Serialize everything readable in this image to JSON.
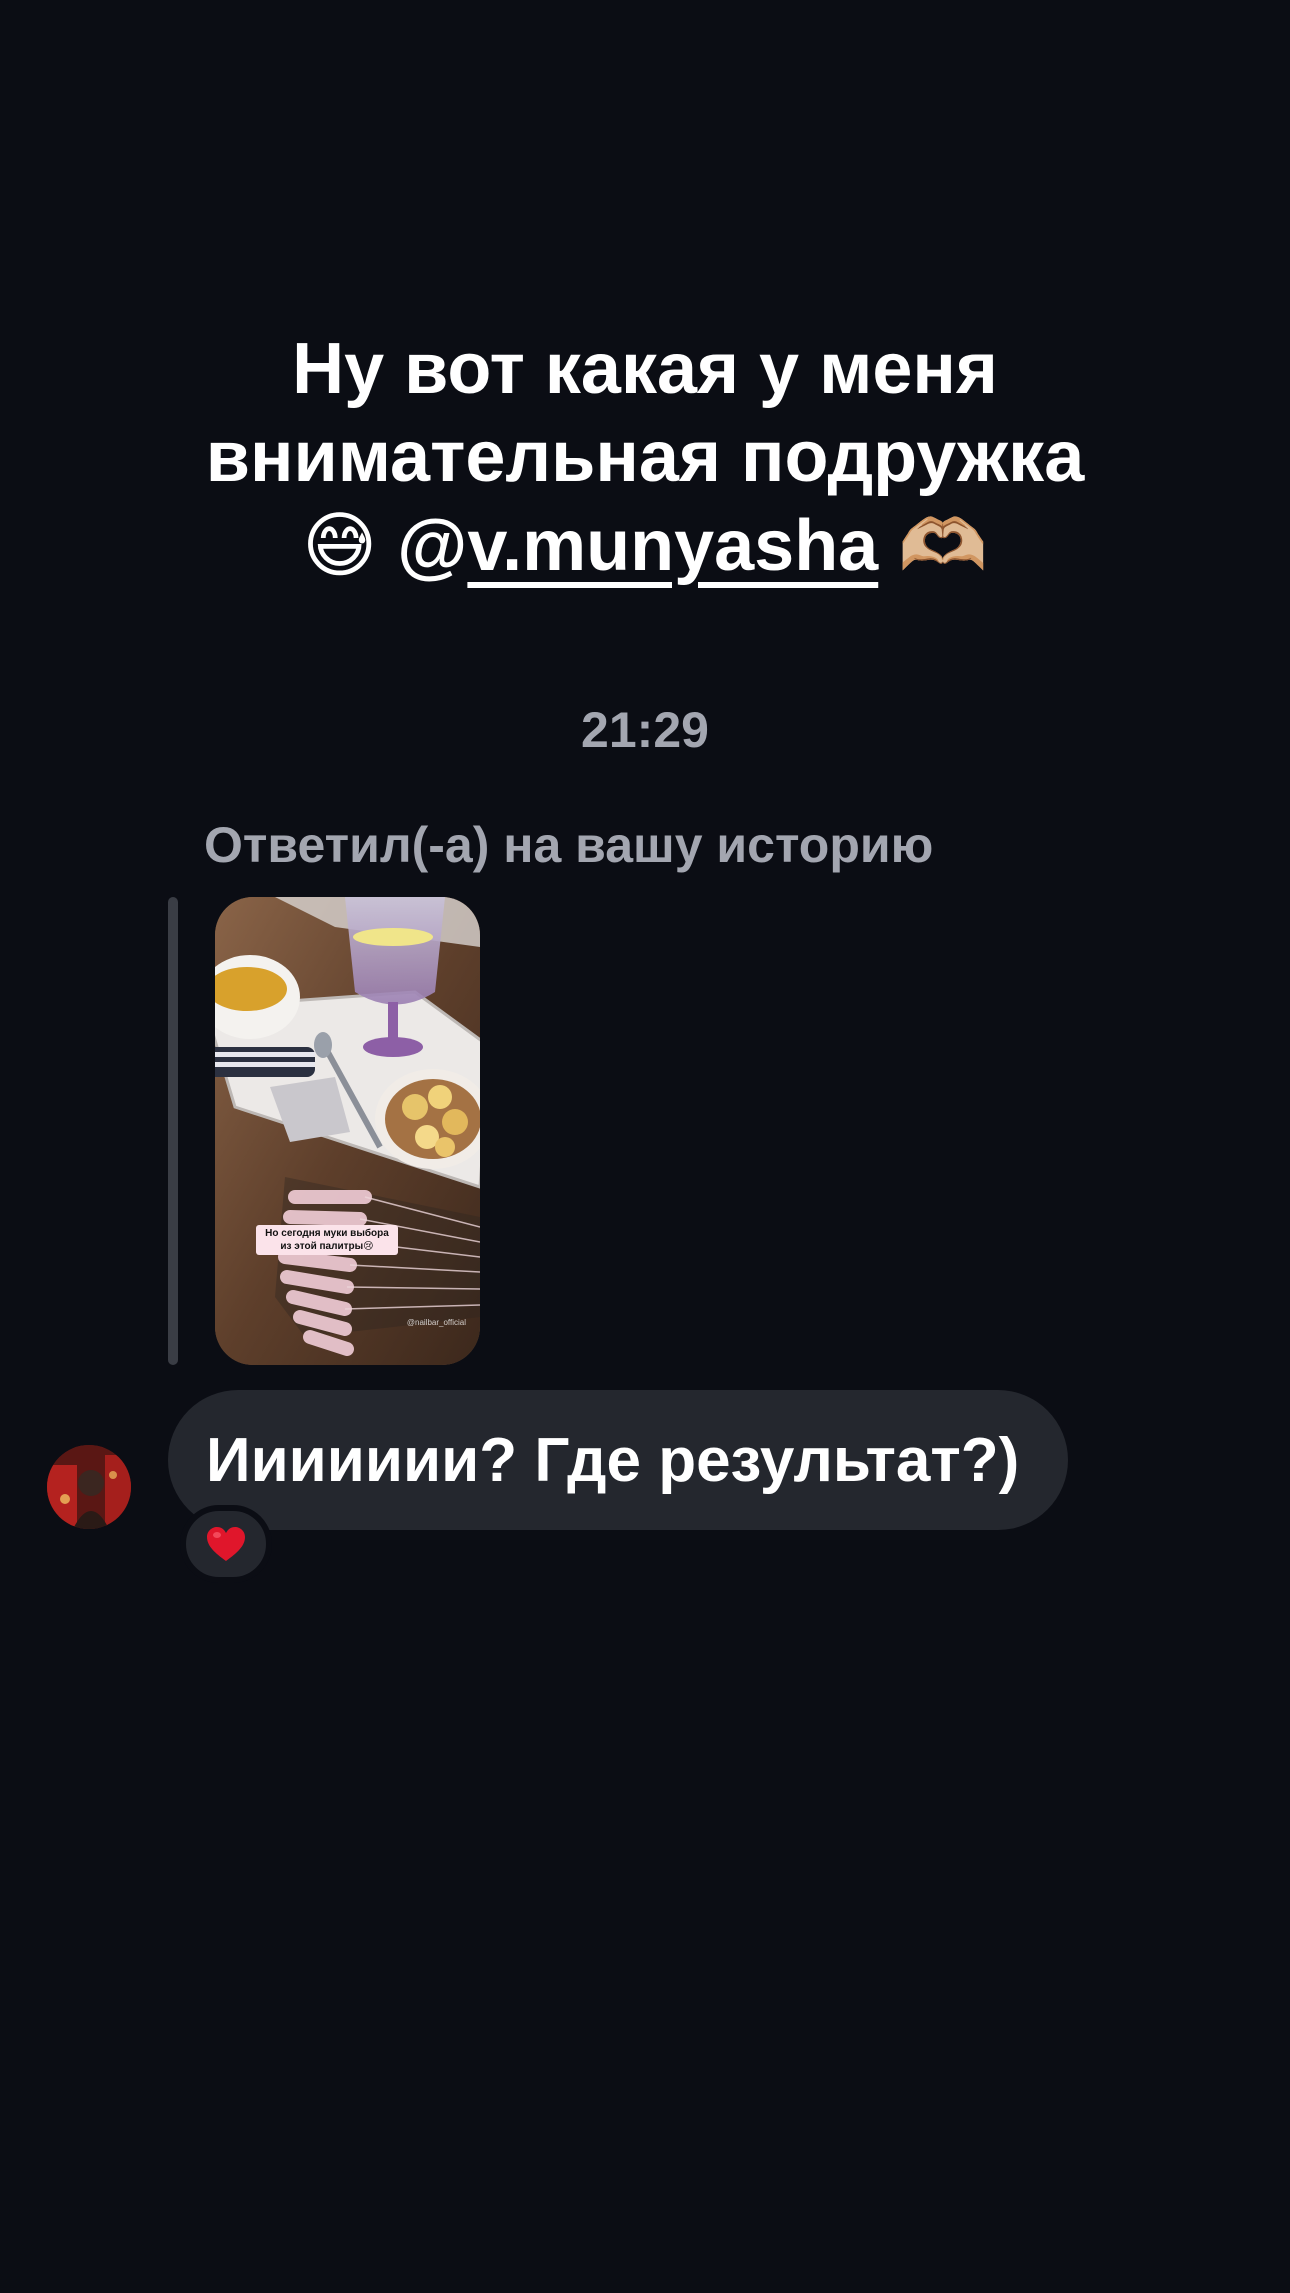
{
  "caption": {
    "line1": "Ну вот какая у меня",
    "line2": "внимательная подружка",
    "emoji_sweat": "😅",
    "mention_at": "@",
    "mention_name": "v.munyasha",
    "emoji_heart_hands": "🫶🏼"
  },
  "chat": {
    "timestamp": "21:29",
    "reply_label": "Ответил(-а) на вашу историю",
    "story": {
      "sticker_text": "Но сегодня муки выбора из этой палитры😢",
      "handle": "@nailbar_official"
    },
    "message": {
      "text": "Иииииии? Где результат?)",
      "reaction": "❤"
    }
  },
  "colors": {
    "background": "#0b0d14",
    "bubble": "#24272e",
    "muted_text": "#a3a6b0",
    "reaction_heart": "#e0162b"
  }
}
